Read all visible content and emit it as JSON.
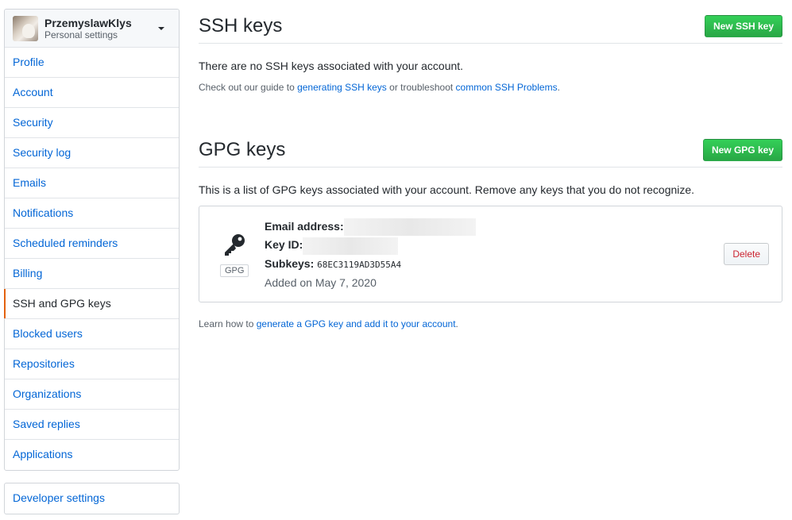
{
  "user": {
    "name": "PrzemyslawKlys",
    "subtitle": "Personal settings"
  },
  "sidebar": {
    "items": [
      {
        "label": "Profile",
        "selected": false
      },
      {
        "label": "Account",
        "selected": false
      },
      {
        "label": "Security",
        "selected": false
      },
      {
        "label": "Security log",
        "selected": false
      },
      {
        "label": "Emails",
        "selected": false
      },
      {
        "label": "Notifications",
        "selected": false
      },
      {
        "label": "Scheduled reminders",
        "selected": false
      },
      {
        "label": "Billing",
        "selected": false
      },
      {
        "label": "SSH and GPG keys",
        "selected": true
      },
      {
        "label": "Blocked users",
        "selected": false
      },
      {
        "label": "Repositories",
        "selected": false
      },
      {
        "label": "Organizations",
        "selected": false
      },
      {
        "label": "Saved replies",
        "selected": false
      },
      {
        "label": "Applications",
        "selected": false
      }
    ],
    "developer_settings": "Developer settings"
  },
  "ssh": {
    "title": "SSH keys",
    "new_button": "New SSH key",
    "empty_message": "There are no SSH keys associated with your account.",
    "guide_prefix": "Check out our guide to ",
    "guide_link": "generating SSH keys",
    "guide_middle": " or troubleshoot ",
    "problems_link": "common SSH Problems",
    "guide_suffix": "."
  },
  "gpg": {
    "title": "GPG keys",
    "new_button": "New GPG key",
    "description": "This is a list of GPG keys associated with your account. Remove any keys that you do not recognize.",
    "key": {
      "badge": "GPG",
      "email_label": "Email address:",
      "keyid_label": "Key ID:",
      "subkeys_label": "Subkeys:",
      "subkeys_value": "68EC3119AD3D55A4",
      "added": "Added on May 7, 2020",
      "delete_button": "Delete"
    },
    "footer_prefix": "Learn how to ",
    "footer_link": "generate a GPG key and add it to your account",
    "footer_suffix": "."
  },
  "colors": {
    "primary": "#28a745",
    "link": "#0366d6",
    "danger": "#cb2431",
    "selected_marker": "#e36209"
  },
  "icons": {
    "key": "key-icon",
    "caret": "caret-down-icon"
  }
}
